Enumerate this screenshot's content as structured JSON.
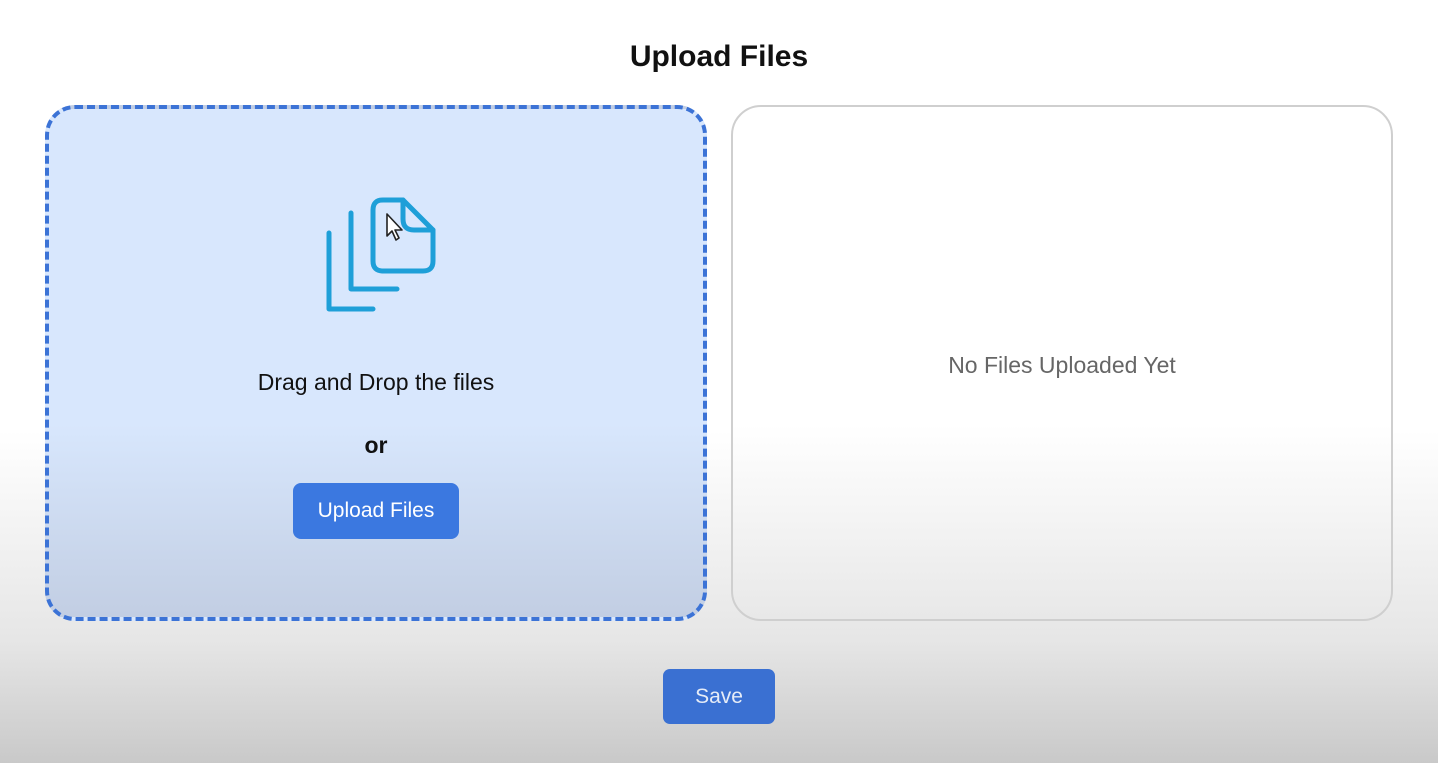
{
  "page": {
    "title": "Upload Files"
  },
  "drop_zone": {
    "icon": "files-icon",
    "instruction": "Drag and Drop the files",
    "separator": "or",
    "upload_button_label": "Upload Files",
    "border_color": "#3c73d6",
    "background_color": "#d8e7fd",
    "icon_color": "#1e9fd8"
  },
  "uploaded_files": {
    "empty_message": "No Files Uploaded Yet",
    "items": []
  },
  "footer": {
    "save_label": "Save",
    "button_color": "#3a70d2"
  },
  "cursor": {
    "icon": "mouse-pointer-icon"
  }
}
